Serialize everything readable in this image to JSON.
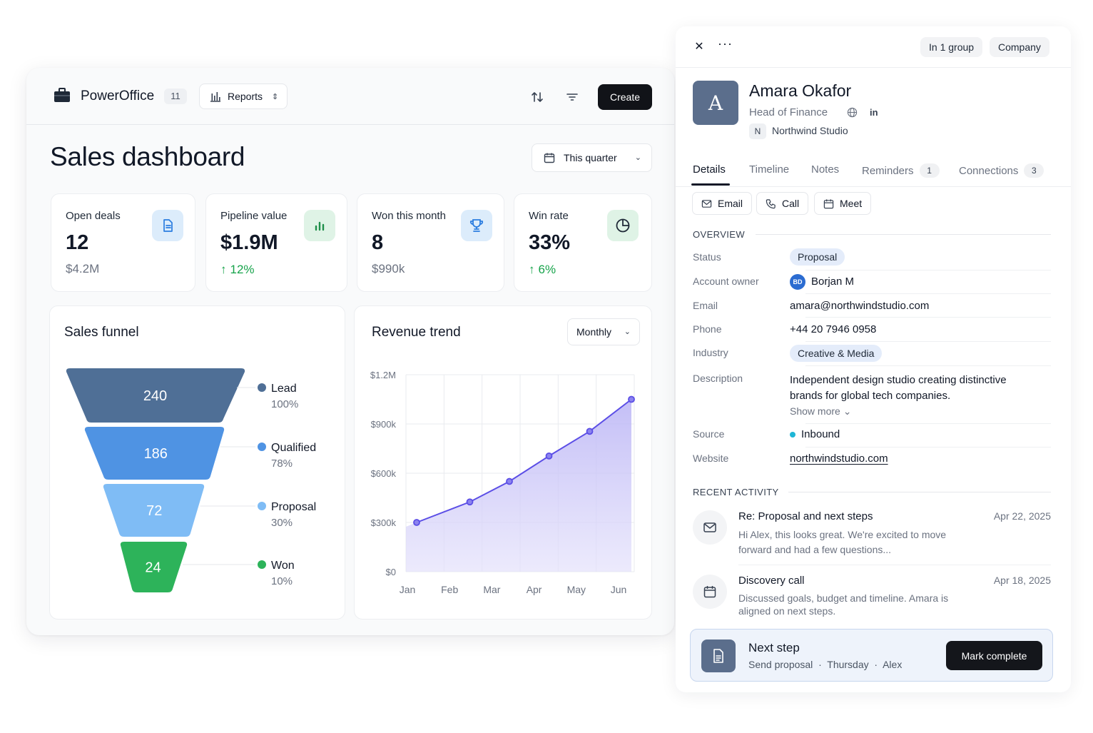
{
  "dashboard": {
    "app_name": "PowerOffice",
    "app_count": "11",
    "reports_label": "Reports",
    "create_label": "Create",
    "title": "Sales dashboard",
    "period_label": "This quarter",
    "kpis": [
      {
        "label": "Open deals",
        "value": "12",
        "sub": "$4.2M",
        "icon": "document-icon"
      },
      {
        "label": "Pipeline value",
        "value": "$1.9M",
        "change": "12%",
        "icon": "bar-chart-icon"
      },
      {
        "label": "Won this month",
        "value": "8",
        "sub": "$990k",
        "icon": "trophy-icon"
      },
      {
        "label": "Win rate",
        "value": "33%",
        "change": "6%",
        "icon": "pie-chart-icon"
      }
    ],
    "funnel": {
      "title": "Sales funnel",
      "stages": [
        {
          "name": "Lead",
          "count": "240",
          "pct": "100%",
          "color": "#4f6f96"
        },
        {
          "name": "Qualified",
          "count": "186",
          "pct": "78%",
          "color": "#4f93e3"
        },
        {
          "name": "Proposal",
          "count": "72",
          "pct": "30%",
          "color": "#7fbcf5"
        },
        {
          "name": "Won",
          "count": "24",
          "pct": "10%",
          "color": "#2db35a"
        }
      ]
    },
    "revenue": {
      "title": "Revenue trend",
      "period_select": "Monthly"
    }
  },
  "chart_data": {
    "type": "area",
    "title": "Revenue trend",
    "categories": [
      "Jan",
      "Feb",
      "Mar",
      "Apr",
      "May",
      "Jun"
    ],
    "x_extra_points": [
      "Jan",
      "Feb",
      "Mar",
      "Apr",
      "May",
      "Jun"
    ],
    "series": [
      {
        "values": [
          300000,
          425000,
          550000,
          705000,
          855000,
          1050000
        ],
        "color": "#5b4ee6"
      }
    ],
    "point_x_fraction": [
      0.05,
      0.245,
      0.43,
      0.615,
      0.805,
      1.0
    ],
    "y_ticks": [
      "$1.2M",
      "$900k",
      "$600k",
      "$300k",
      "$0"
    ],
    "ylim": [
      0,
      1200000
    ],
    "grid": true
  },
  "contact": {
    "group_pill": "In 1 group",
    "type_pill": "Company",
    "avatar_letter": "A",
    "name": "Amara Okafor",
    "role": "Head of Finance",
    "linkedin": "in",
    "company_badge": "N",
    "company": "Northwind Studio",
    "tabs": [
      {
        "label": "Details",
        "count": ""
      },
      {
        "label": "Timeline",
        "count": ""
      },
      {
        "label": "Notes",
        "count": ""
      },
      {
        "label": "Reminders",
        "count": "1"
      },
      {
        "label": "Connections",
        "count": "3"
      }
    ],
    "actions": [
      "Email",
      "Call",
      "Meet"
    ],
    "overview_heading": "OVERVIEW",
    "fields": {
      "status_label": "Status",
      "status": "Proposal",
      "owner_label": "Account owner",
      "owner_initials": "BD",
      "owner": "Borjan M",
      "email_label": "Email",
      "email": "amara@northwindstudio.com",
      "phone_label": "Phone",
      "phone": "+44 20 7946 0958",
      "industry_label": "Industry",
      "industry": "Creative & Media",
      "description_label": "Description",
      "description": "Independent design studio creating distinctive brands for global tech companies.",
      "show_more": "Show more",
      "source_label": "Source",
      "source": "Inbound",
      "website_label": "Website",
      "website": "northwindstudio.com"
    },
    "activity_heading": "RECENT ACTIVITY",
    "activity": [
      {
        "title": "Re: Proposal and next steps",
        "date": "Apr 22, 2025",
        "body": "Hi Alex, this looks great. We're excited to move forward and had a few questions...",
        "icon": "mail-icon"
      },
      {
        "title": "Discovery call",
        "date": "Apr 18, 2025",
        "body": "Discussed goals, budget and timeline. Amara is aligned on next steps.",
        "icon": "calendar-icon"
      }
    ],
    "next_step": {
      "title": "Next step",
      "detail": "Send proposal",
      "day": "Thursday",
      "owner": "Alex",
      "button": "Mark complete"
    }
  }
}
